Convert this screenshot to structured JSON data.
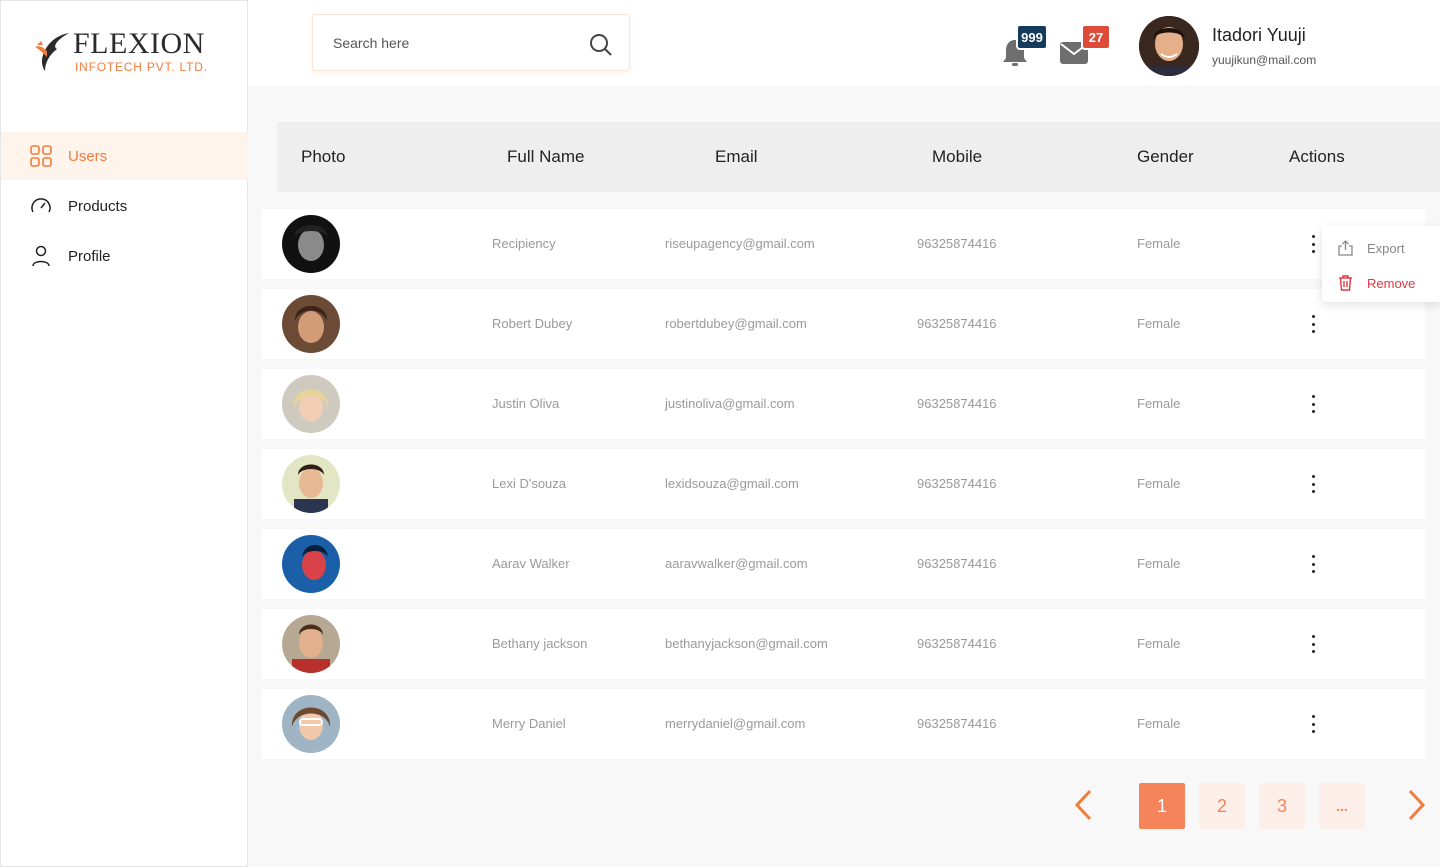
{
  "brand": {
    "name": "FLEXION",
    "subtitle": "INFOTECH PVT. LTD.",
    "accent": "#f27c3c"
  },
  "sidebar": {
    "items": [
      {
        "label": "Users",
        "icon": "grid-icon",
        "active": true
      },
      {
        "label": "Products",
        "icon": "gauge-icon",
        "active": false
      },
      {
        "label": "Profile",
        "icon": "user-icon",
        "active": false
      }
    ]
  },
  "search": {
    "placeholder": "Search here",
    "value": ""
  },
  "notifications": {
    "count": "999",
    "icon": "bell-icon",
    "color": "#143a5c"
  },
  "messages": {
    "count": "27",
    "icon": "mail-icon",
    "color": "#dd4b39"
  },
  "user": {
    "name": "Itadori Yuuji",
    "email": "yuujikun@mail.com"
  },
  "table": {
    "columns": [
      "Photo",
      "Full Name",
      "Email",
      "Mobile",
      "Gender",
      "Actions"
    ],
    "rows": [
      {
        "name": "Recipiency",
        "email": "riseupagency@gmail.com",
        "mobile": "96325874416",
        "gender": "Female"
      },
      {
        "name": "Robert Dubey",
        "email": "robertdubey@gmail.com",
        "mobile": "96325874416",
        "gender": "Female"
      },
      {
        "name": "Justin Oliva",
        "email": "justinoliva@gmail.com",
        "mobile": "96325874416",
        "gender": "Female"
      },
      {
        "name": "Lexi D'souza",
        "email": "lexidsouza@gmail.com",
        "mobile": "96325874416",
        "gender": "Female"
      },
      {
        "name": "Aarav Walker",
        "email": "aaravwalker@gmail.com",
        "mobile": "96325874416",
        "gender": "Female"
      },
      {
        "name": "Bethany jackson",
        "email": "bethanyjackson@gmail.com",
        "mobile": "96325874416",
        "gender": "Female"
      },
      {
        "name": "Merry Daniel",
        "email": "merrydaniel@gmail.com",
        "mobile": "96325874416",
        "gender": "Female"
      }
    ]
  },
  "actions_menu": {
    "export_label": "Export",
    "remove_label": "Remove",
    "remove_color": "#e0353f"
  },
  "pagination": {
    "pages": [
      "1",
      "2",
      "3",
      "..."
    ],
    "current": "1"
  }
}
